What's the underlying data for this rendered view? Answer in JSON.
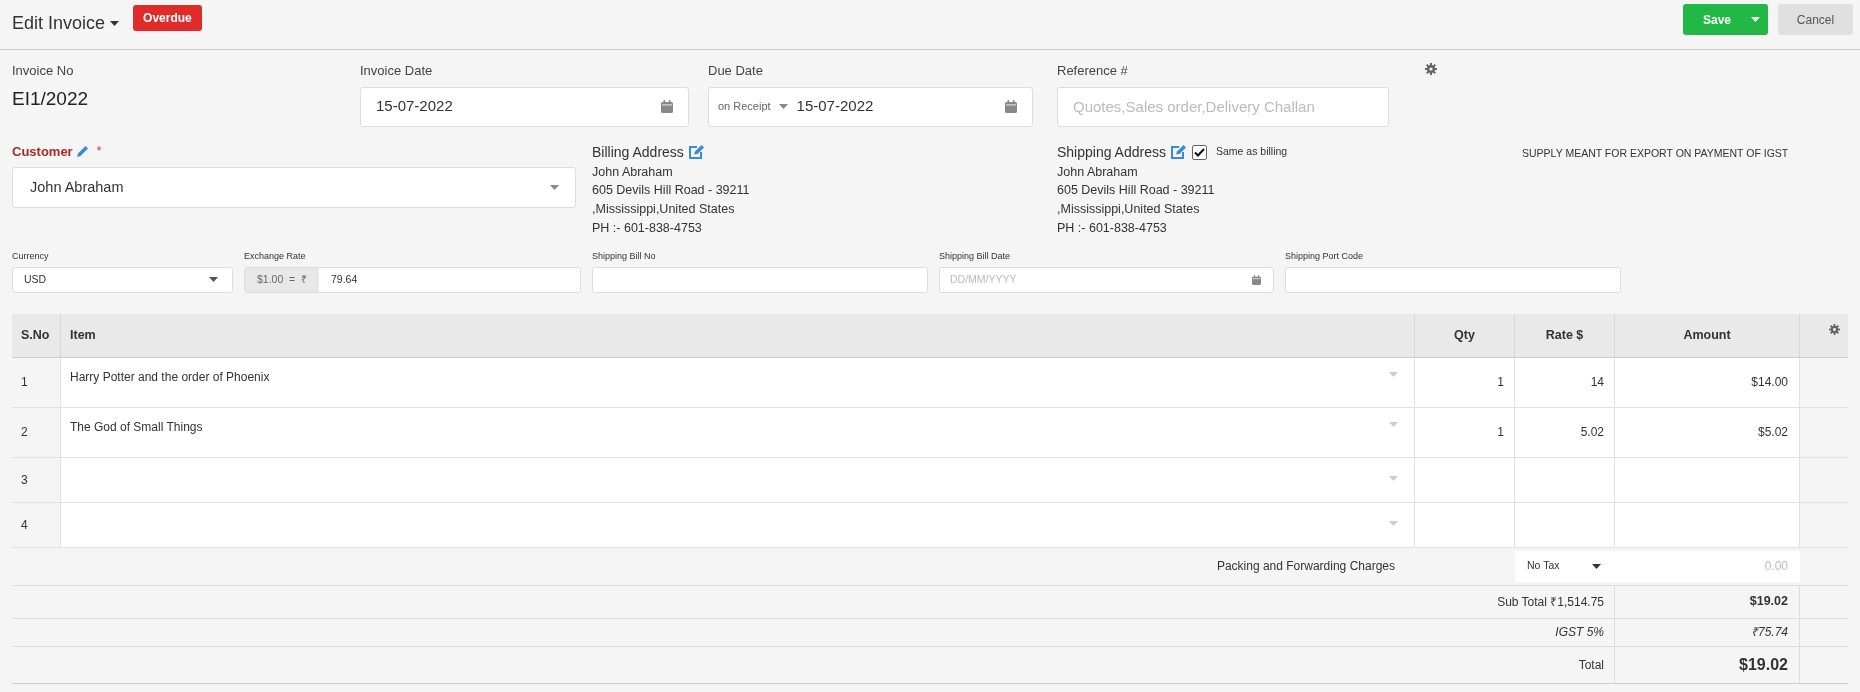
{
  "header": {
    "title": "Edit Invoice",
    "status_badge": "Overdue",
    "save_button": "Save",
    "cancel_button": "Cancel"
  },
  "invoice_no": {
    "label": "Invoice No",
    "value": "EI1/2022"
  },
  "invoice_date": {
    "label": "Invoice Date",
    "value": "15-07-2022"
  },
  "due_date": {
    "label": "Due Date",
    "term": "on Receipt",
    "value": "15-07-2022"
  },
  "reference": {
    "label": "Reference #",
    "placeholder": "Quotes,Sales order,Delivery Challan"
  },
  "customer": {
    "label": "Customer",
    "required_mark": "*",
    "value": "John Abraham"
  },
  "billing_address": {
    "label": "Billing Address",
    "lines": [
      "John Abraham",
      "605 Devils Hill Road - 39211",
      ",Mississippi,United States",
      "PH :- 601-838-4753"
    ]
  },
  "shipping_address": {
    "label": "Shipping Address",
    "same_as_billing": {
      "label": "Same as billing",
      "checked": true
    },
    "lines": [
      "John Abraham",
      "605 Devils Hill Road - 39211",
      ",Mississippi,United States",
      "PH :- 601-838-4753"
    ]
  },
  "supply_note": "SUPPLY MEANT FOR EXPORT ON PAYMENT OF IGST",
  "fields": [
    {
      "label": "Currency",
      "kind": "select",
      "value": "USD"
    },
    {
      "label": "Exchange Rate",
      "kind": "rate",
      "prefix": "$1.00  =  ₹",
      "value": "79.64"
    },
    {
      "label": "Shipping Bill No",
      "kind": "text"
    },
    {
      "label": "Shipping Bill Date",
      "kind": "date",
      "placeholder": "DD/MM/YYYY"
    },
    {
      "label": "Shipping Port Code",
      "kind": "text"
    }
  ],
  "items_table": {
    "columns": [
      "S.No",
      "Item",
      "Qty",
      "Rate $",
      "Amount"
    ],
    "rows": [
      {
        "sno": "1",
        "item": "Harry Potter and the order of Phoenix",
        "qty": "1",
        "rate": "14",
        "amount": "$14.00"
      },
      {
        "sno": "2",
        "item": "The God of Small Things",
        "qty": "1",
        "rate": "5.02",
        "amount": "$5.02"
      },
      {
        "sno": "3"
      },
      {
        "sno": "4"
      }
    ]
  },
  "totals": {
    "packing_label": "Packing and Forwarding Charges",
    "tax_select": "No Tax",
    "packing_placeholder": "0.00",
    "sub_total_label": "Sub Total ₹1,514.75",
    "sub_total": "$19.02",
    "tax_label": "IGST 5%",
    "tax_amount": "₹75.74",
    "total_label": "Total",
    "total": "$19.02"
  }
}
